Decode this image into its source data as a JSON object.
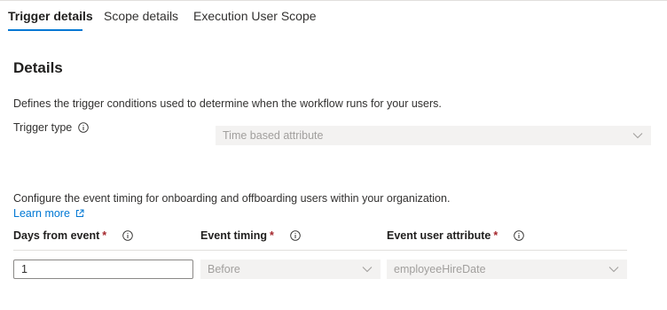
{
  "tabs": [
    {
      "label": "Trigger details",
      "active": true
    },
    {
      "label": "Scope details",
      "active": false
    },
    {
      "label": "Execution User Scope",
      "active": false
    }
  ],
  "details": {
    "title": "Details",
    "description": "Defines the trigger conditions used to determine when the workflow runs for your users.",
    "trigger_type_label": "Trigger type",
    "trigger_type_value": "Time based attribute"
  },
  "timing": {
    "description": "Configure the event timing for onboarding and offboarding users within your organization.",
    "learn_more": "Learn more",
    "days_label": "Days from event",
    "days_value": "1",
    "event_timing_label": "Event timing",
    "event_timing_value": "Before",
    "event_attr_label": "Event user attribute",
    "event_attr_value": "employeeHireDate",
    "required_mark": "*"
  },
  "colors": {
    "accent": "#0078d4",
    "required": "#a4262c",
    "disabled_bg": "#f3f2f1"
  },
  "icons": [
    "info-icon",
    "chevron-down-icon",
    "external-link-icon"
  ]
}
